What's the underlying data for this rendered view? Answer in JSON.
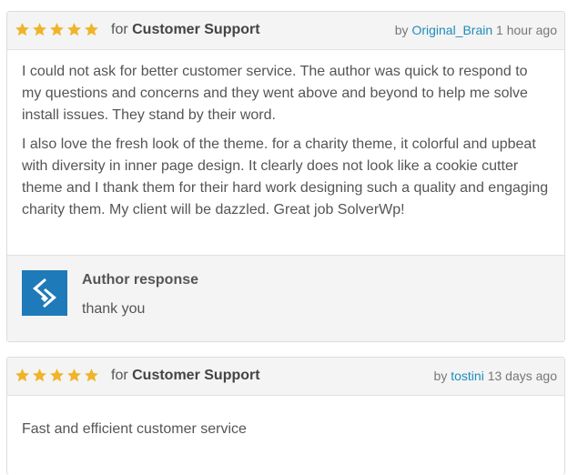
{
  "reviews": [
    {
      "rating": 5,
      "for_word": "for",
      "category": "Customer Support",
      "by_word": "by",
      "author": "Original_Brain",
      "time": "1 hour ago",
      "paragraphs": [
        "I could not ask for better customer service. The author was quick to respond to my questions and concerns and they went above and beyond to help me solve install issues. They stand by their word.",
        "I also love the fresh look of the theme. for a charity theme, it colorful and upbeat with diversity in inner page design. It clearly does not look like a cookie cutter theme and I thank them for their hard work designing such a quality and engaging charity them. My client will be dazzled. Great job SolverWp!"
      ],
      "response": {
        "title": "Author response",
        "text": "thank you"
      }
    },
    {
      "rating": 5,
      "for_word": "for",
      "category": "Customer Support",
      "by_word": "by",
      "author": "tostini",
      "time": "13 days ago",
      "paragraphs": [
        "Fast and efficient customer service"
      ]
    }
  ],
  "colors": {
    "star": "#f0b429",
    "link": "#1e8cbe",
    "logo_bg": "#1e7ab8"
  },
  "icons": {
    "star": "star-icon",
    "logo": "solverwp-logo-icon"
  }
}
